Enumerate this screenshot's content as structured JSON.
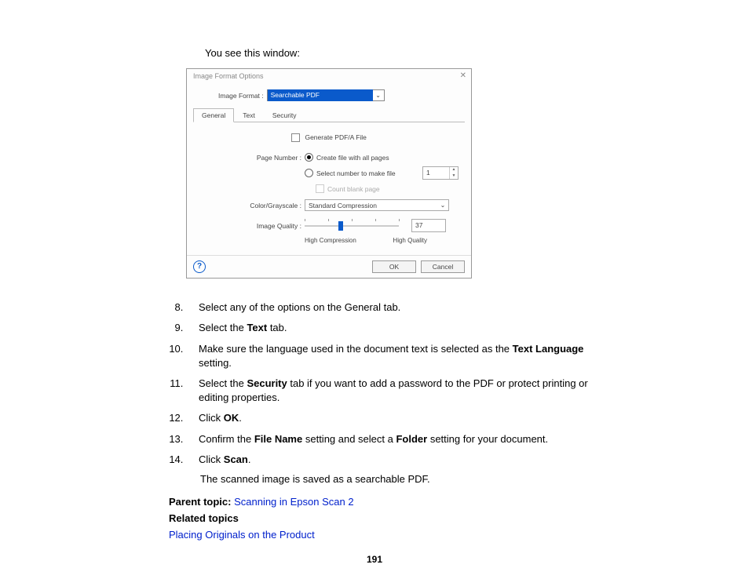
{
  "intro": "You see this window:",
  "dialog": {
    "title": "Image Format Options",
    "imageFormatLabel": "Image Format :",
    "imageFormatValue": "Searchable PDF",
    "tabs": {
      "general": "General",
      "text": "Text",
      "security": "Security"
    },
    "generatePdfA": "Generate PDF/A File",
    "pageNumberLabel": "Page Number :",
    "opt1": "Create file with all pages",
    "opt2": "Select number to make file",
    "spinnerValue": "1",
    "countBlank": "Count blank page",
    "colorLabel": "Color/Grayscale :",
    "colorValue": "Standard Compression",
    "qualityLabel": "Image Quality :",
    "qualityValue": "37",
    "highCompression": "High Compression",
    "highQuality": "High Quality",
    "ok": "OK",
    "cancel": "Cancel",
    "help": "?"
  },
  "steps": {
    "s8": "Select any of the options on the General tab.",
    "s9a": "Select the ",
    "s9b": "Text",
    "s9c": " tab.",
    "s10a": "Make sure the language used in the document text is selected as the ",
    "s10b": "Text Language",
    "s10c": " setting.",
    "s11a": "Select the ",
    "s11b": "Security",
    "s11c": " tab if you want to add a password to the PDF or protect printing or editing properties.",
    "s12a": "Click ",
    "s12b": "OK",
    "s12c": ".",
    "s13a": "Confirm the ",
    "s13b": "File Name",
    "s13c": " setting and select a ",
    "s13d": "Folder",
    "s13e": " setting for your document.",
    "s14a": "Click ",
    "s14b": "Scan",
    "s14c": "."
  },
  "subnote": "The scanned image is saved as a searchable PDF.",
  "parentTopicLabel": "Parent topic: ",
  "parentTopicLink": "Scanning in Epson Scan 2",
  "relatedTopicsLabel": "Related topics",
  "relatedLink": "Placing Originals on the Product",
  "pageNumber": "191"
}
